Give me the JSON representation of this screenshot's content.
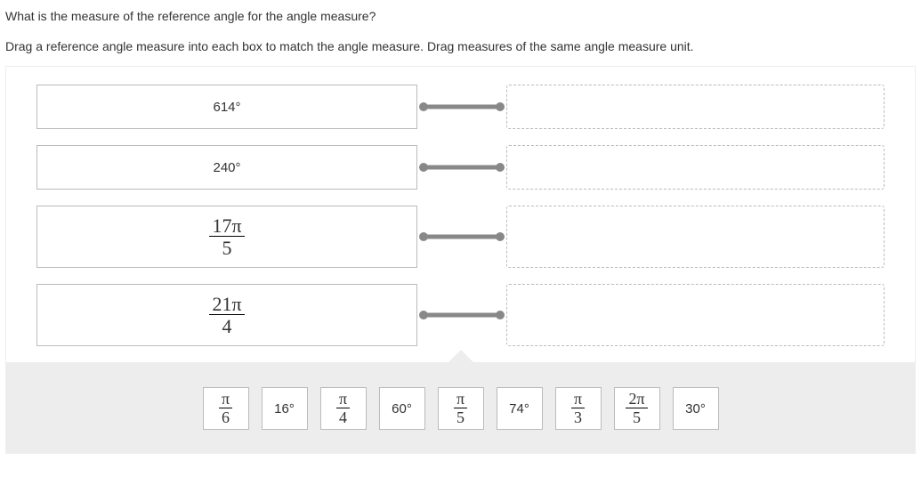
{
  "question": "What is the measure of the reference angle for the angle measure?",
  "instructions": "Drag a reference angle measure into each box to match the angle measure. Drag measures of the same angle measure unit.",
  "rows": [
    {
      "type": "deg",
      "label": "614°"
    },
    {
      "type": "deg",
      "label": "240°"
    },
    {
      "type": "frac",
      "num": "17π",
      "den": "5"
    },
    {
      "type": "frac",
      "num": "21π",
      "den": "4"
    }
  ],
  "chips": [
    {
      "type": "frac",
      "num": "π",
      "den": "6"
    },
    {
      "type": "deg",
      "label": "16°"
    },
    {
      "type": "frac",
      "num": "π",
      "den": "4"
    },
    {
      "type": "deg",
      "label": "60°"
    },
    {
      "type": "frac",
      "num": "π",
      "den": "5"
    },
    {
      "type": "deg",
      "label": "74°"
    },
    {
      "type": "frac",
      "num": "π",
      "den": "3"
    },
    {
      "type": "frac",
      "num": "2π",
      "den": "5"
    },
    {
      "type": "deg",
      "label": "30°"
    }
  ]
}
